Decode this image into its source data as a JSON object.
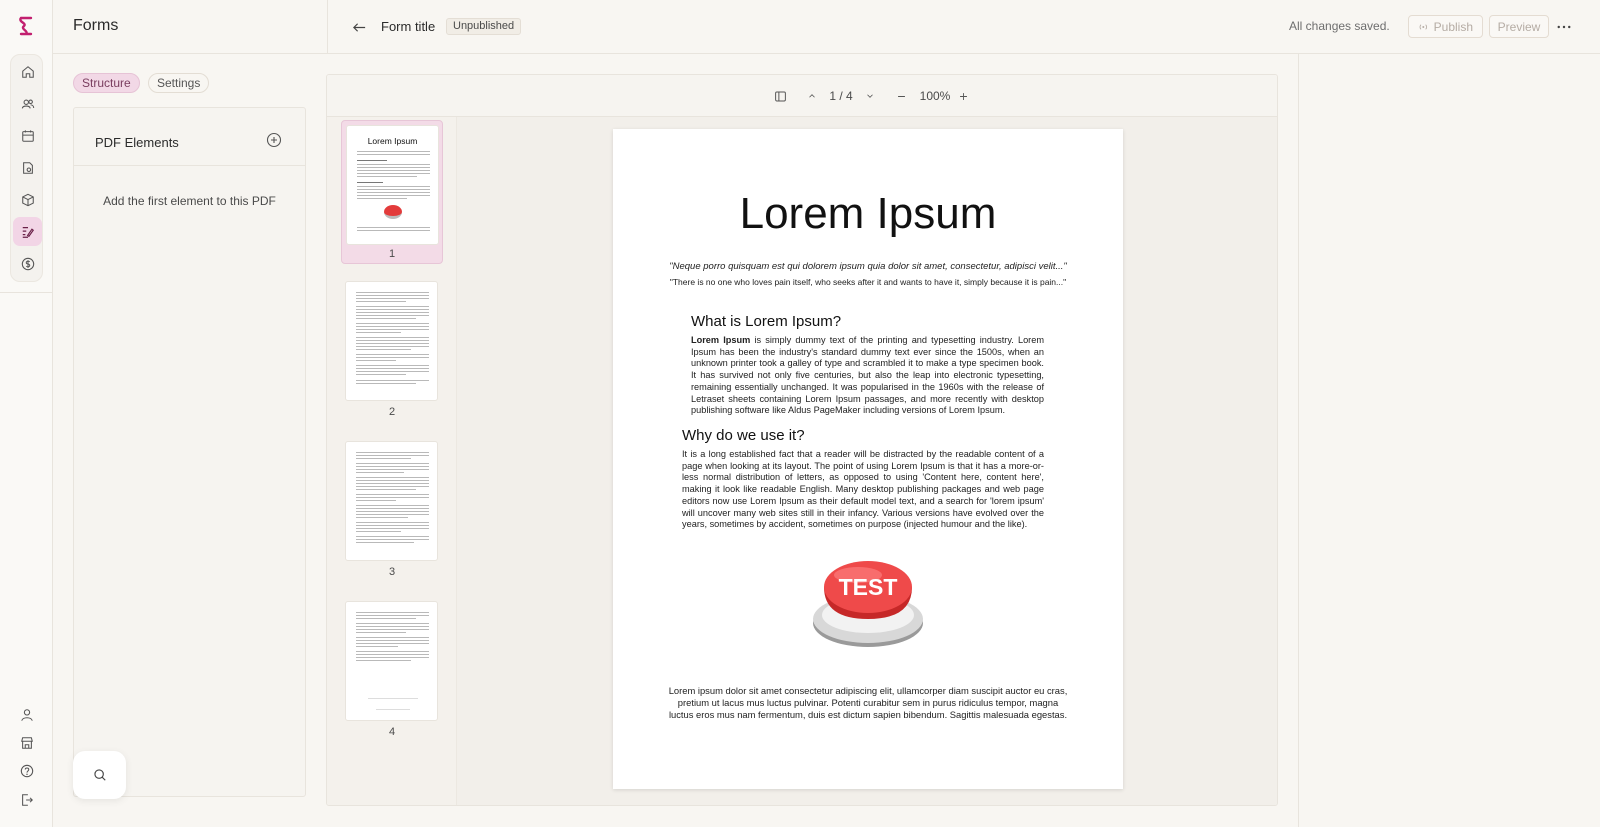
{
  "app": {
    "section_title": "Forms",
    "brand_color": "#c2206f"
  },
  "rail": {
    "top_icons": [
      "home-icon",
      "users-icon",
      "calendar-icon",
      "file-settings-icon",
      "package-icon",
      "form-edit-icon",
      "dollar-icon"
    ],
    "active": "form-edit-icon",
    "bottom_icons": [
      "user-icon",
      "store-icon",
      "help-icon",
      "logout-icon"
    ]
  },
  "header": {
    "form_title": "Form title",
    "status": "Unpublished",
    "saved_status": "All changes saved.",
    "publish_label": "Publish",
    "preview_label": "Preview"
  },
  "structure": {
    "tabs": [
      {
        "label": "Structure",
        "active": true
      },
      {
        "label": "Settings",
        "active": false
      }
    ],
    "panel_title": "PDF Elements",
    "empty_message": "Add the first element to this PDF"
  },
  "viewer": {
    "page_indicator": "1 / 4",
    "zoom": "100%",
    "thumbnails": [
      {
        "number": "1",
        "active": true
      },
      {
        "number": "2",
        "active": false
      },
      {
        "number": "3",
        "active": false
      },
      {
        "number": "4",
        "active": false
      }
    ],
    "thumb_title": "Lorem Ipsum"
  },
  "pdf": {
    "title": "Lorem Ipsum",
    "quote1": "\"Neque porro quisquam est qui dolorem ipsum quia dolor sit amet, consectetur, adipisci velit...\"",
    "quote2": "\"There is no one who loves pain itself, who seeks after it and wants to have it, simply because it is pain...\"",
    "h2_what": "What is Lorem Ipsum?",
    "p1_bold": "Lorem Ipsum",
    "p1_rest": " is simply dummy text of the printing and typesetting industry. Lorem Ipsum has been the industry's standard dummy text ever since the 1500s, when an unknown printer took a galley of type and scrambled it to make a type specimen book. It has survived not only five centuries, but also the leap into electronic typesetting, remaining essentially unchanged. It was popularised in the 1960s with the release of Letraset sheets containing Lorem Ipsum passages, and more recently with desktop publishing software like Aldus PageMaker including versions of Lorem Ipsum.",
    "h2_why": "Why do we use it?",
    "p2": "It is a long established fact that a reader will be distracted by the readable content of a page when looking at its layout. The point of using Lorem Ipsum is that it has a more-or-less normal distribution of letters, as opposed to using 'Content here, content here', making it look like readable English. Many desktop publishing packages and web page editors now use Lorem Ipsum as their default model text, and a search for 'lorem ipsum' will uncover many web sites still in their infancy. Various versions have evolved over the years, sometimes by accident, sometimes on purpose (injected humour and the like).",
    "button_label": "TEST",
    "p3": "Lorem ipsum dolor sit amet consectetur adipiscing elit, ullamcorper diam suscipit auctor eu cras, pretium ut lacus mus luctus pulvinar. Potenti curabitur sem in purus ridiculus tempor, magna luctus eros mus nam fermentum, duis est dictum sapien bibendum. Sagittis malesuada egestas."
  }
}
